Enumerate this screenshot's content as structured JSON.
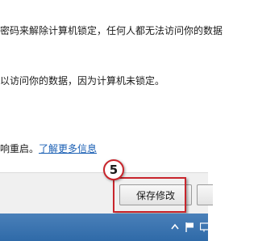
{
  "content": {
    "line1": "密码来解除计算机锁定，任何人都无法访问你的数据",
    "line2": "以访问你的数据，因为计算机未锁定。",
    "line3_prefix": "响重启。",
    "line3_link": "了解更多信息"
  },
  "footer": {
    "save_label": "保存修改"
  },
  "annotation": {
    "step_number": "5",
    "highlight_color": "#c8252c"
  },
  "taskbar": {
    "color": "#3a73b0",
    "icons": [
      "up-arrow-icon",
      "flag-icon",
      "monitor-icon"
    ]
  }
}
